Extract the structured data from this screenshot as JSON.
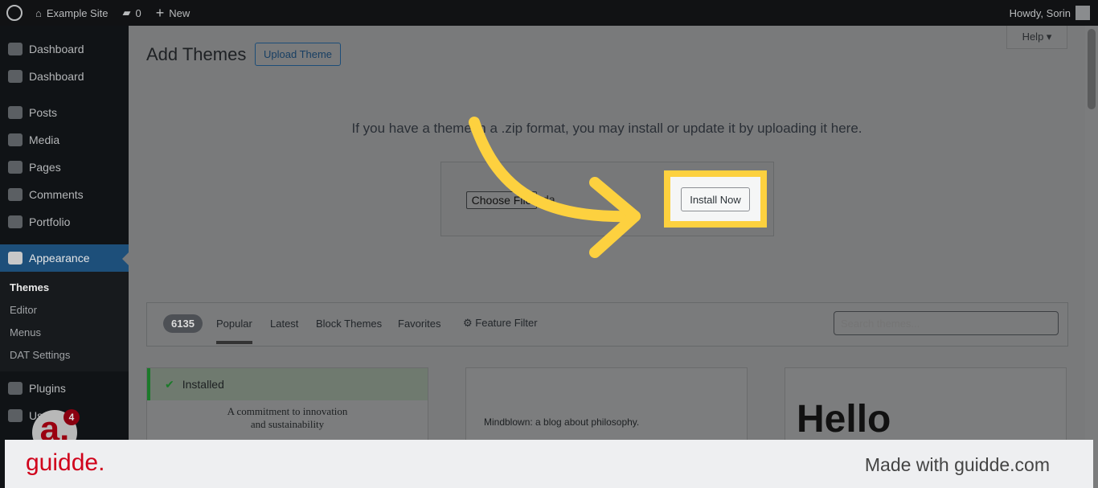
{
  "topbar": {
    "site": "Example Site",
    "comments": "0",
    "new": "New",
    "howdy": "Howdy, Sorin"
  },
  "sidebar": {
    "items": [
      "Dashboard",
      "Dashboard",
      "Posts",
      "Media",
      "Pages",
      "Comments",
      "Portfolio",
      "Appearance",
      "Plugins",
      "Users"
    ],
    "submenu": [
      "Themes",
      "Editor",
      "Menus",
      "DAT Settings"
    ],
    "users_badge": "4"
  },
  "header": {
    "title": "Add Themes",
    "upload": "Upload Theme",
    "help": "Help ▾"
  },
  "upload": {
    "text": "If you have a theme in a .zip format, you may install or update it by uploading it here.",
    "choose": "Choose File",
    "file": "da",
    "install": "Install Now"
  },
  "filter": {
    "count": "6135",
    "tabs": [
      "Popular",
      "Latest",
      "Block Themes",
      "Favorites"
    ],
    "feature": "Feature Filter",
    "search_placeholder": "Search themes..."
  },
  "themes": [
    {
      "badge": "Installed",
      "heading": "A commitment to innovation and sustainability"
    },
    {
      "heading": "Mindblown: a blog about philosophy."
    },
    {
      "heading": "Hello"
    }
  ],
  "footer": {
    "logo": "guidde.",
    "tagline": "Made with guidde.com"
  },
  "colors": {
    "highlight": "#fdd13f",
    "logo": "#d0021b"
  }
}
